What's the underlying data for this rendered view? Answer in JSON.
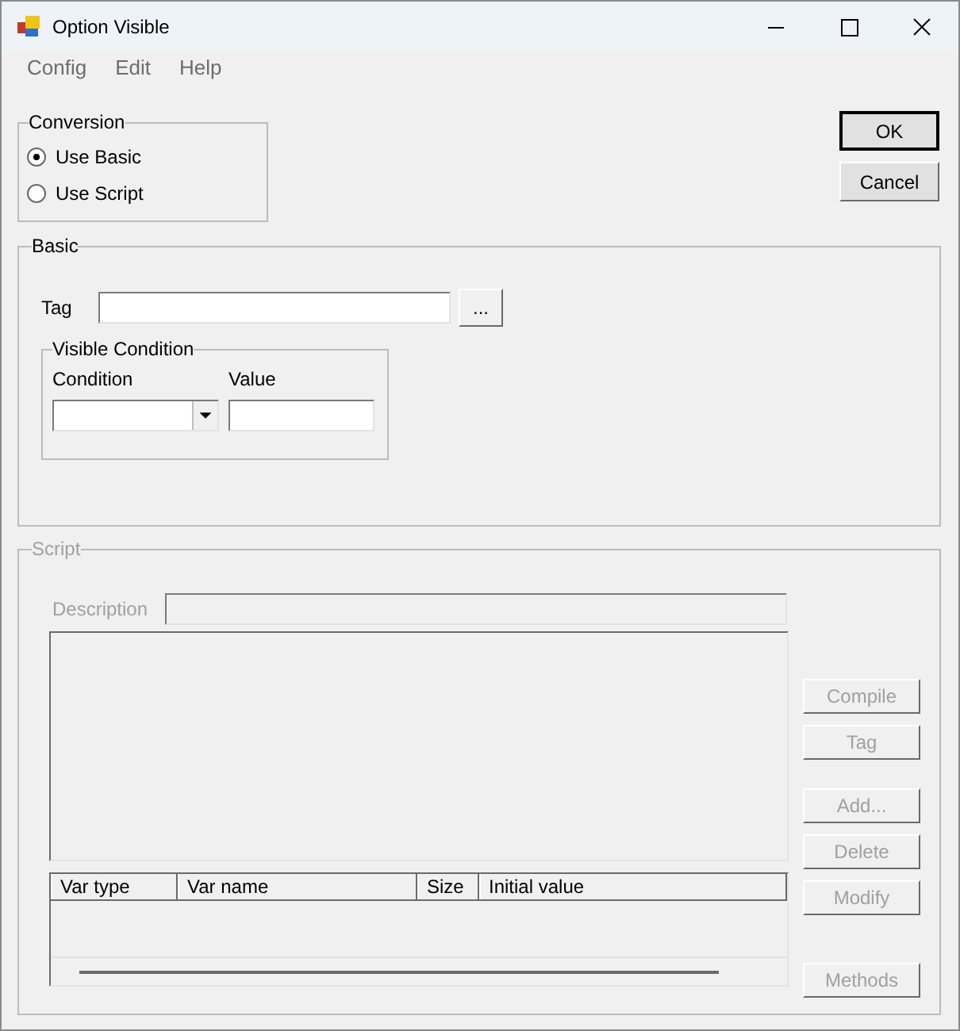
{
  "window": {
    "title": "Option Visible"
  },
  "menu": [
    "Config",
    "Edit",
    "Help"
  ],
  "conversion": {
    "title": "Conversion",
    "options": [
      {
        "label": "Use Basic",
        "selected": true
      },
      {
        "label": "Use Script",
        "selected": false
      }
    ]
  },
  "dialog_buttons": [
    {
      "label": "OK",
      "default": true
    },
    {
      "label": "Cancel",
      "default": false
    }
  ],
  "basic": {
    "title": "Basic",
    "disabled": false,
    "tag_label": "Tag",
    "browse_button": "...",
    "visible_condition": {
      "title": "Visible Condition",
      "condition_label": "Condition",
      "value_label": "Value"
    }
  },
  "script": {
    "title": "Script",
    "disabled": true,
    "description_label": "Description",
    "variables_table": {
      "columns": [
        "Var type",
        "Var name",
        "Size",
        "Initial value"
      ]
    },
    "buttons": [
      {
        "label": "Compile",
        "disabled": true
      },
      {
        "label": "Tag",
        "disabled": true
      },
      {
        "label": "Add...",
        "disabled": true
      },
      {
        "label": "Delete",
        "disabled": true
      },
      {
        "label": "Modify",
        "disabled": true
      },
      {
        "label": "Methods",
        "disabled": true
      }
    ]
  }
}
